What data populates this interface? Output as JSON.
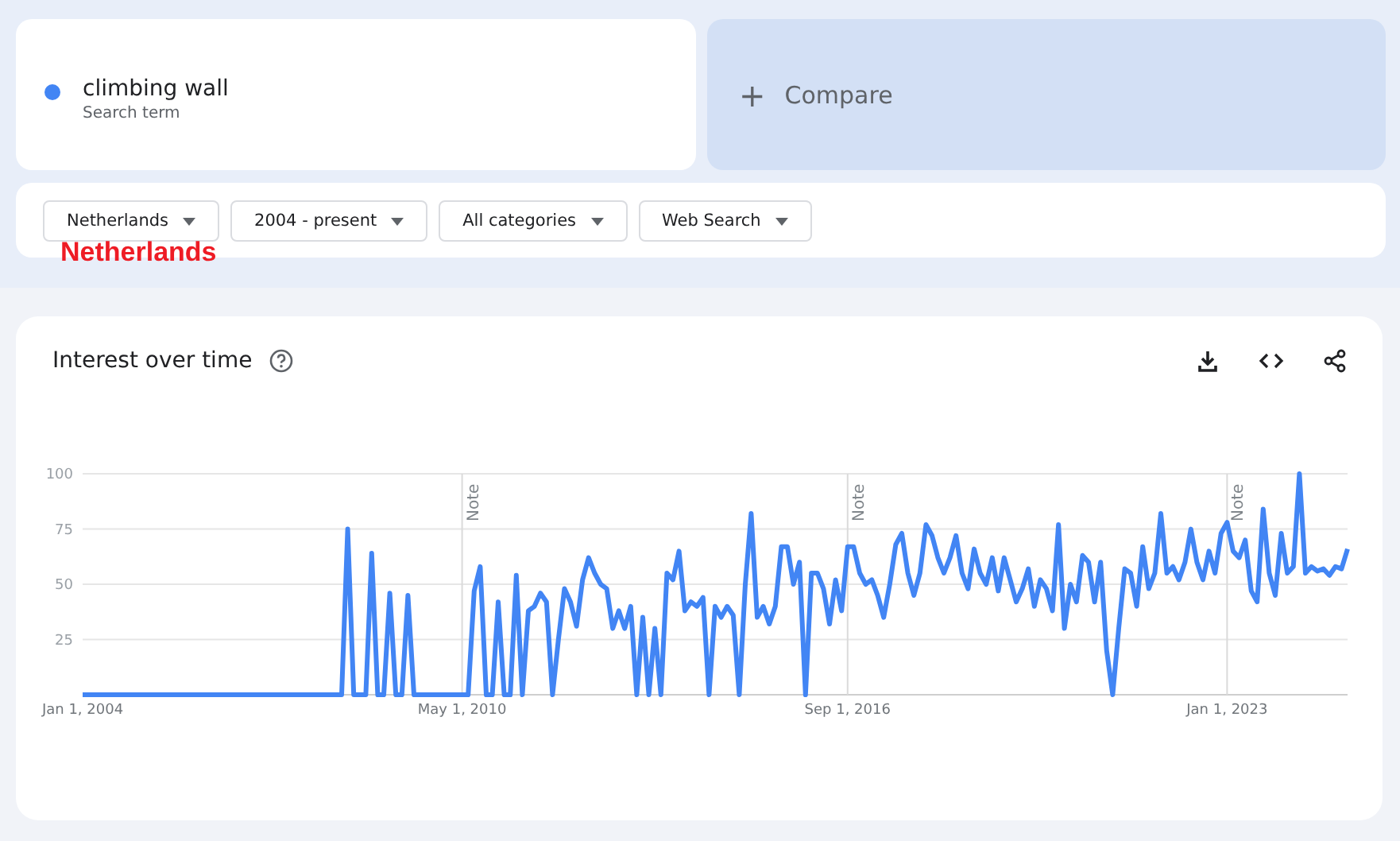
{
  "search_term": {
    "name": "climbing wall",
    "caption": "Search term",
    "color": "#4285f4"
  },
  "compare": {
    "label": "Compare",
    "icon": "+"
  },
  "filters": [
    {
      "label": "Netherlands"
    },
    {
      "label": "2004 - present"
    },
    {
      "label": "All categories"
    },
    {
      "label": "Web Search"
    }
  ],
  "overlay_label": "Netherlands",
  "panel": {
    "title": "Interest over time",
    "chart_data": {
      "type": "line",
      "grid": true,
      "categories": [
        "Jan 1, 2004",
        null,
        null,
        null,
        null,
        null,
        null,
        null,
        null,
        null,
        null,
        null,
        null,
        null,
        null,
        null,
        null,
        null,
        null,
        null,
        null,
        null,
        null,
        null,
        null,
        null,
        null,
        null,
        null,
        null,
        null,
        null,
        null,
        null,
        null,
        null,
        null,
        null,
        null,
        null,
        null,
        null,
        null,
        null,
        null,
        null,
        null,
        null,
        null,
        null,
        null,
        null,
        null,
        null,
        null,
        null,
        null,
        null,
        null,
        null,
        null,
        null,
        null,
        "May 1, 2010",
        null,
        null,
        null,
        null,
        null,
        null,
        null,
        null,
        null,
        null,
        null,
        null,
        null,
        null,
        null,
        null,
        null,
        null,
        null,
        null,
        null,
        null,
        null,
        null,
        null,
        null,
        null,
        null,
        null,
        null,
        null,
        null,
        null,
        null,
        null,
        null,
        null,
        null,
        null,
        null,
        null,
        null,
        null,
        null,
        null,
        null,
        null,
        null,
        null,
        null,
        null,
        null,
        null,
        null,
        null,
        null,
        null,
        null,
        null,
        null,
        null,
        null,
        null,
        "Sep 1, 2016",
        null,
        null,
        null,
        null,
        null,
        null,
        null,
        null,
        null,
        null,
        null,
        null,
        null,
        null,
        null,
        null,
        null,
        null,
        null,
        null,
        null,
        null,
        null,
        null,
        null,
        null,
        null,
        null,
        null,
        null,
        null,
        null,
        null,
        null,
        null,
        null,
        null,
        null,
        null,
        null,
        null,
        null,
        null,
        null,
        null,
        null,
        null,
        null,
        null,
        null,
        null,
        null,
        null,
        null,
        null,
        null,
        null,
        null,
        null,
        null,
        null,
        null,
        "Jan 1, 2023",
        null,
        null,
        null,
        null,
        null,
        null,
        null,
        null,
        null,
        null,
        null,
        null,
        null,
        null,
        null,
        null,
        null,
        null,
        null,
        null
      ],
      "series": [
        {
          "color": "#4285f4",
          "values": [
            0,
            0,
            0,
            0,
            0,
            0,
            0,
            0,
            0,
            0,
            0,
            0,
            0,
            0,
            0,
            0,
            0,
            0,
            0,
            0,
            0,
            0,
            0,
            0,
            0,
            0,
            0,
            0,
            0,
            0,
            0,
            0,
            0,
            0,
            0,
            0,
            0,
            0,
            0,
            0,
            0,
            0,
            0,
            0,
            75,
            0,
            0,
            0,
            64,
            0,
            0,
            46,
            0,
            0,
            45,
            0,
            0,
            0,
            0,
            0,
            0,
            0,
            0,
            0,
            0,
            47,
            58,
            0,
            0,
            42,
            0,
            0,
            54,
            0,
            38,
            40,
            46,
            42,
            0,
            25,
            48,
            42,
            31,
            52,
            62,
            55,
            50,
            48,
            30,
            38,
            30,
            40,
            0,
            35,
            0,
            30,
            0,
            55,
            52,
            65,
            38,
            42,
            40,
            44,
            0,
            40,
            35,
            40,
            36,
            0,
            50,
            82,
            35,
            40,
            32,
            40,
            67,
            67,
            50,
            60,
            0,
            55,
            55,
            48,
            32,
            52,
            38,
            67,
            67,
            55,
            50,
            52,
            45,
            35,
            50,
            68,
            73,
            55,
            45,
            55,
            77,
            72,
            62,
            55,
            62,
            72,
            55,
            48,
            66,
            55,
            50,
            62,
            47,
            62,
            52,
            42,
            48,
            57,
            40,
            52,
            48,
            38,
            77,
            30,
            50,
            42,
            63,
            60,
            42,
            60,
            20,
            0,
            30,
            57,
            55,
            40,
            67,
            48,
            55,
            82,
            55,
            58,
            52,
            60,
            75,
            60,
            52,
            65,
            55,
            73,
            78,
            65,
            62,
            70,
            47,
            42,
            84,
            55,
            45,
            73,
            55,
            58,
            100,
            55,
            58,
            56,
            57,
            54,
            58,
            57,
            66
          ]
        }
      ],
      "ylim": [
        0,
        100
      ],
      "yticks": [
        25,
        50,
        75,
        100
      ],
      "annotations": [
        "Note",
        "Note",
        "Note"
      ]
    }
  }
}
